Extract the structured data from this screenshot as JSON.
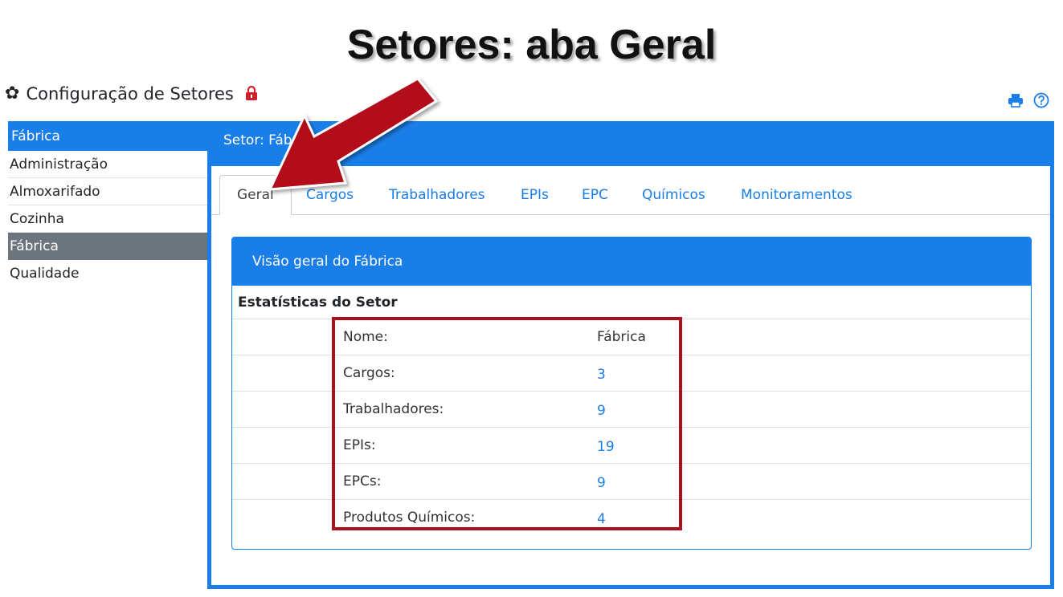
{
  "slide_title": "Setores: aba Geral",
  "page": {
    "title": "Configuração de Setores",
    "icons": [
      "gear-icon",
      "lock-icon",
      "print-icon",
      "help-icon"
    ]
  },
  "sidebar": {
    "header": "Fábrica",
    "items": [
      {
        "label": "Administração",
        "active": false
      },
      {
        "label": "Almoxarifado",
        "active": false
      },
      {
        "label": "Cozinha",
        "active": false
      },
      {
        "label": "Fábrica",
        "active": true
      },
      {
        "label": "Qualidade",
        "active": false
      }
    ]
  },
  "main": {
    "title": "Setor: Fábrica",
    "tabs": [
      {
        "label": "Geral",
        "active": true
      },
      {
        "label": "Cargos",
        "active": false
      },
      {
        "label": "Trabalhadores",
        "active": false
      },
      {
        "label": "EPIs",
        "active": false
      },
      {
        "label": "EPC",
        "active": false
      },
      {
        "label": "Químicos",
        "active": false
      },
      {
        "label": "Monitoramentos",
        "active": false
      }
    ],
    "card_title": "Visão geral do Fábrica",
    "stats_title": "Estatísticas do Setor",
    "stats": [
      {
        "label": "Nome:",
        "value": "Fábrica"
      },
      {
        "label": "Cargos:",
        "value": "3"
      },
      {
        "label": "Trabalhadores:",
        "value": "9"
      },
      {
        "label": "EPIs:",
        "value": "19"
      },
      {
        "label": "EPCs:",
        "value": "9"
      },
      {
        "label": "Produtos Químicos:",
        "value": "4"
      }
    ]
  },
  "colors": {
    "primary": "#1a7ee8",
    "active_sidebar": "#6c757d",
    "annotation_red": "#a8101c"
  }
}
